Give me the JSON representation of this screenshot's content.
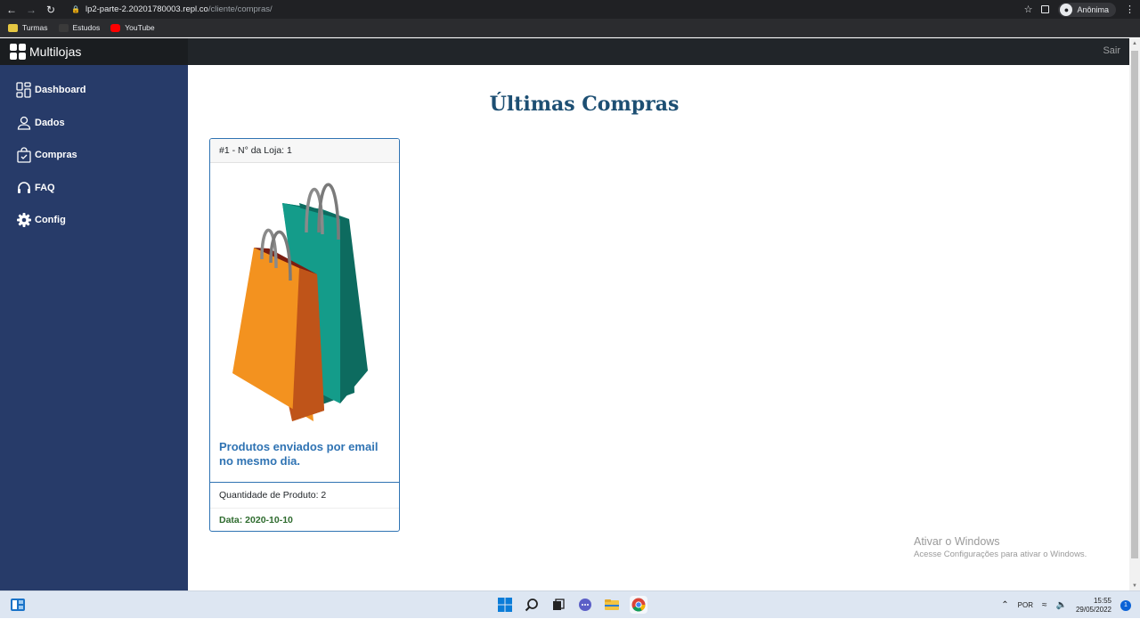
{
  "browser": {
    "url_host": "lp2-parte-2.20201780003.repl.co",
    "url_path": "/cliente/compras/",
    "profile_label": "Anônima",
    "bookmarks": [
      {
        "label": "Turmas",
        "color": "#e5c742"
      },
      {
        "label": "Estudos",
        "color": "#3a3a3a"
      },
      {
        "label": "YouTube",
        "color": "#ff0000"
      }
    ]
  },
  "app": {
    "brand": "Multilojas",
    "logout_label": "Sair"
  },
  "sidebar": {
    "items": [
      {
        "label": "Dashboard",
        "icon": "dashboard-icon"
      },
      {
        "label": "Dados",
        "icon": "person-icon"
      },
      {
        "label": "Compras",
        "icon": "shopping-bag-icon"
      },
      {
        "label": "FAQ",
        "icon": "headset-icon"
      },
      {
        "label": "Config",
        "icon": "gear-icon"
      }
    ]
  },
  "main": {
    "title": "Últimas Compras",
    "card": {
      "header": "#1 - N° da Loja: 1",
      "image": "shopping-bags-illustration",
      "text": "Produtos enviados por email no mesmo dia.",
      "quantity": "Quantidade de Produto: 2",
      "date": "Data: 2020-10-10"
    }
  },
  "watermark": {
    "title": "Ativar o Windows",
    "subtitle": "Acesse Configurações para ativar o Windows."
  },
  "taskbar": {
    "lang": "POR",
    "time": "15:55",
    "date": "29/05/2022",
    "notifications": "1"
  }
}
